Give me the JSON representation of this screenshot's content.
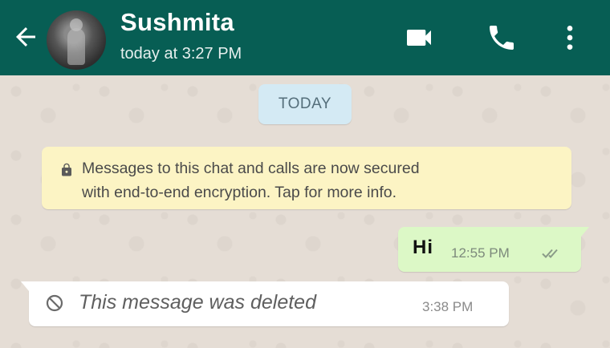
{
  "header": {
    "contact_name": "Sushmita",
    "last_seen": "today at 3:27 PM",
    "icons": [
      "back-arrow-icon",
      "video-call-icon",
      "phone-icon",
      "more-vert-icon"
    ],
    "color": "#075e54"
  },
  "chat": {
    "date_divider": "TODAY",
    "encryption_notice": {
      "line1": "Messages to this chat and calls are now secured",
      "line2": "with end-to-end encryption. Tap for more info."
    },
    "messages": [
      {
        "direction": "outgoing",
        "text": "Hi",
        "time": "12:55 PM",
        "status": "read",
        "bubble_color": "#dcf8c6"
      },
      {
        "direction": "incoming",
        "text": "This message was deleted",
        "time": "3:38 PM",
        "deleted": true,
        "bubble_color": "#ffffff"
      }
    ]
  }
}
